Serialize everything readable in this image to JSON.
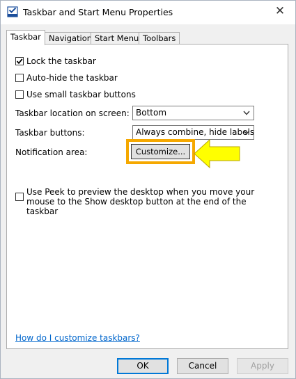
{
  "window": {
    "title": "Taskbar and Start Menu Properties",
    "close_glyph": "✕"
  },
  "tabs": [
    {
      "label": "Taskbar",
      "active": true
    },
    {
      "label": "Navigation",
      "active": false
    },
    {
      "label": "Start Menu",
      "active": false
    },
    {
      "label": "Toolbars",
      "active": false
    }
  ],
  "options": {
    "lock_taskbar": {
      "label": "Lock the taskbar",
      "checked": true
    },
    "auto_hide": {
      "label": "Auto-hide the taskbar",
      "checked": false
    },
    "small_buttons": {
      "label": "Use small taskbar buttons",
      "checked": false
    }
  },
  "location": {
    "label": "Taskbar location on screen:",
    "value": "Bottom"
  },
  "buttons_setting": {
    "label": "Taskbar buttons:",
    "value": "Always combine, hide labels"
  },
  "notification": {
    "label": "Notification area:",
    "button_label": "Customize..."
  },
  "peek": {
    "label": "Use Peek to preview the desktop when you move your mouse to the Show desktop button at the end of the taskbar",
    "checked": false
  },
  "help_link": "How do I customize taskbars?",
  "footer": {
    "ok": "OK",
    "cancel": "Cancel",
    "apply": "Apply"
  },
  "colors": {
    "highlight": "#f5a800",
    "pointer_fill": "#ffff00",
    "link": "#0066cc"
  }
}
